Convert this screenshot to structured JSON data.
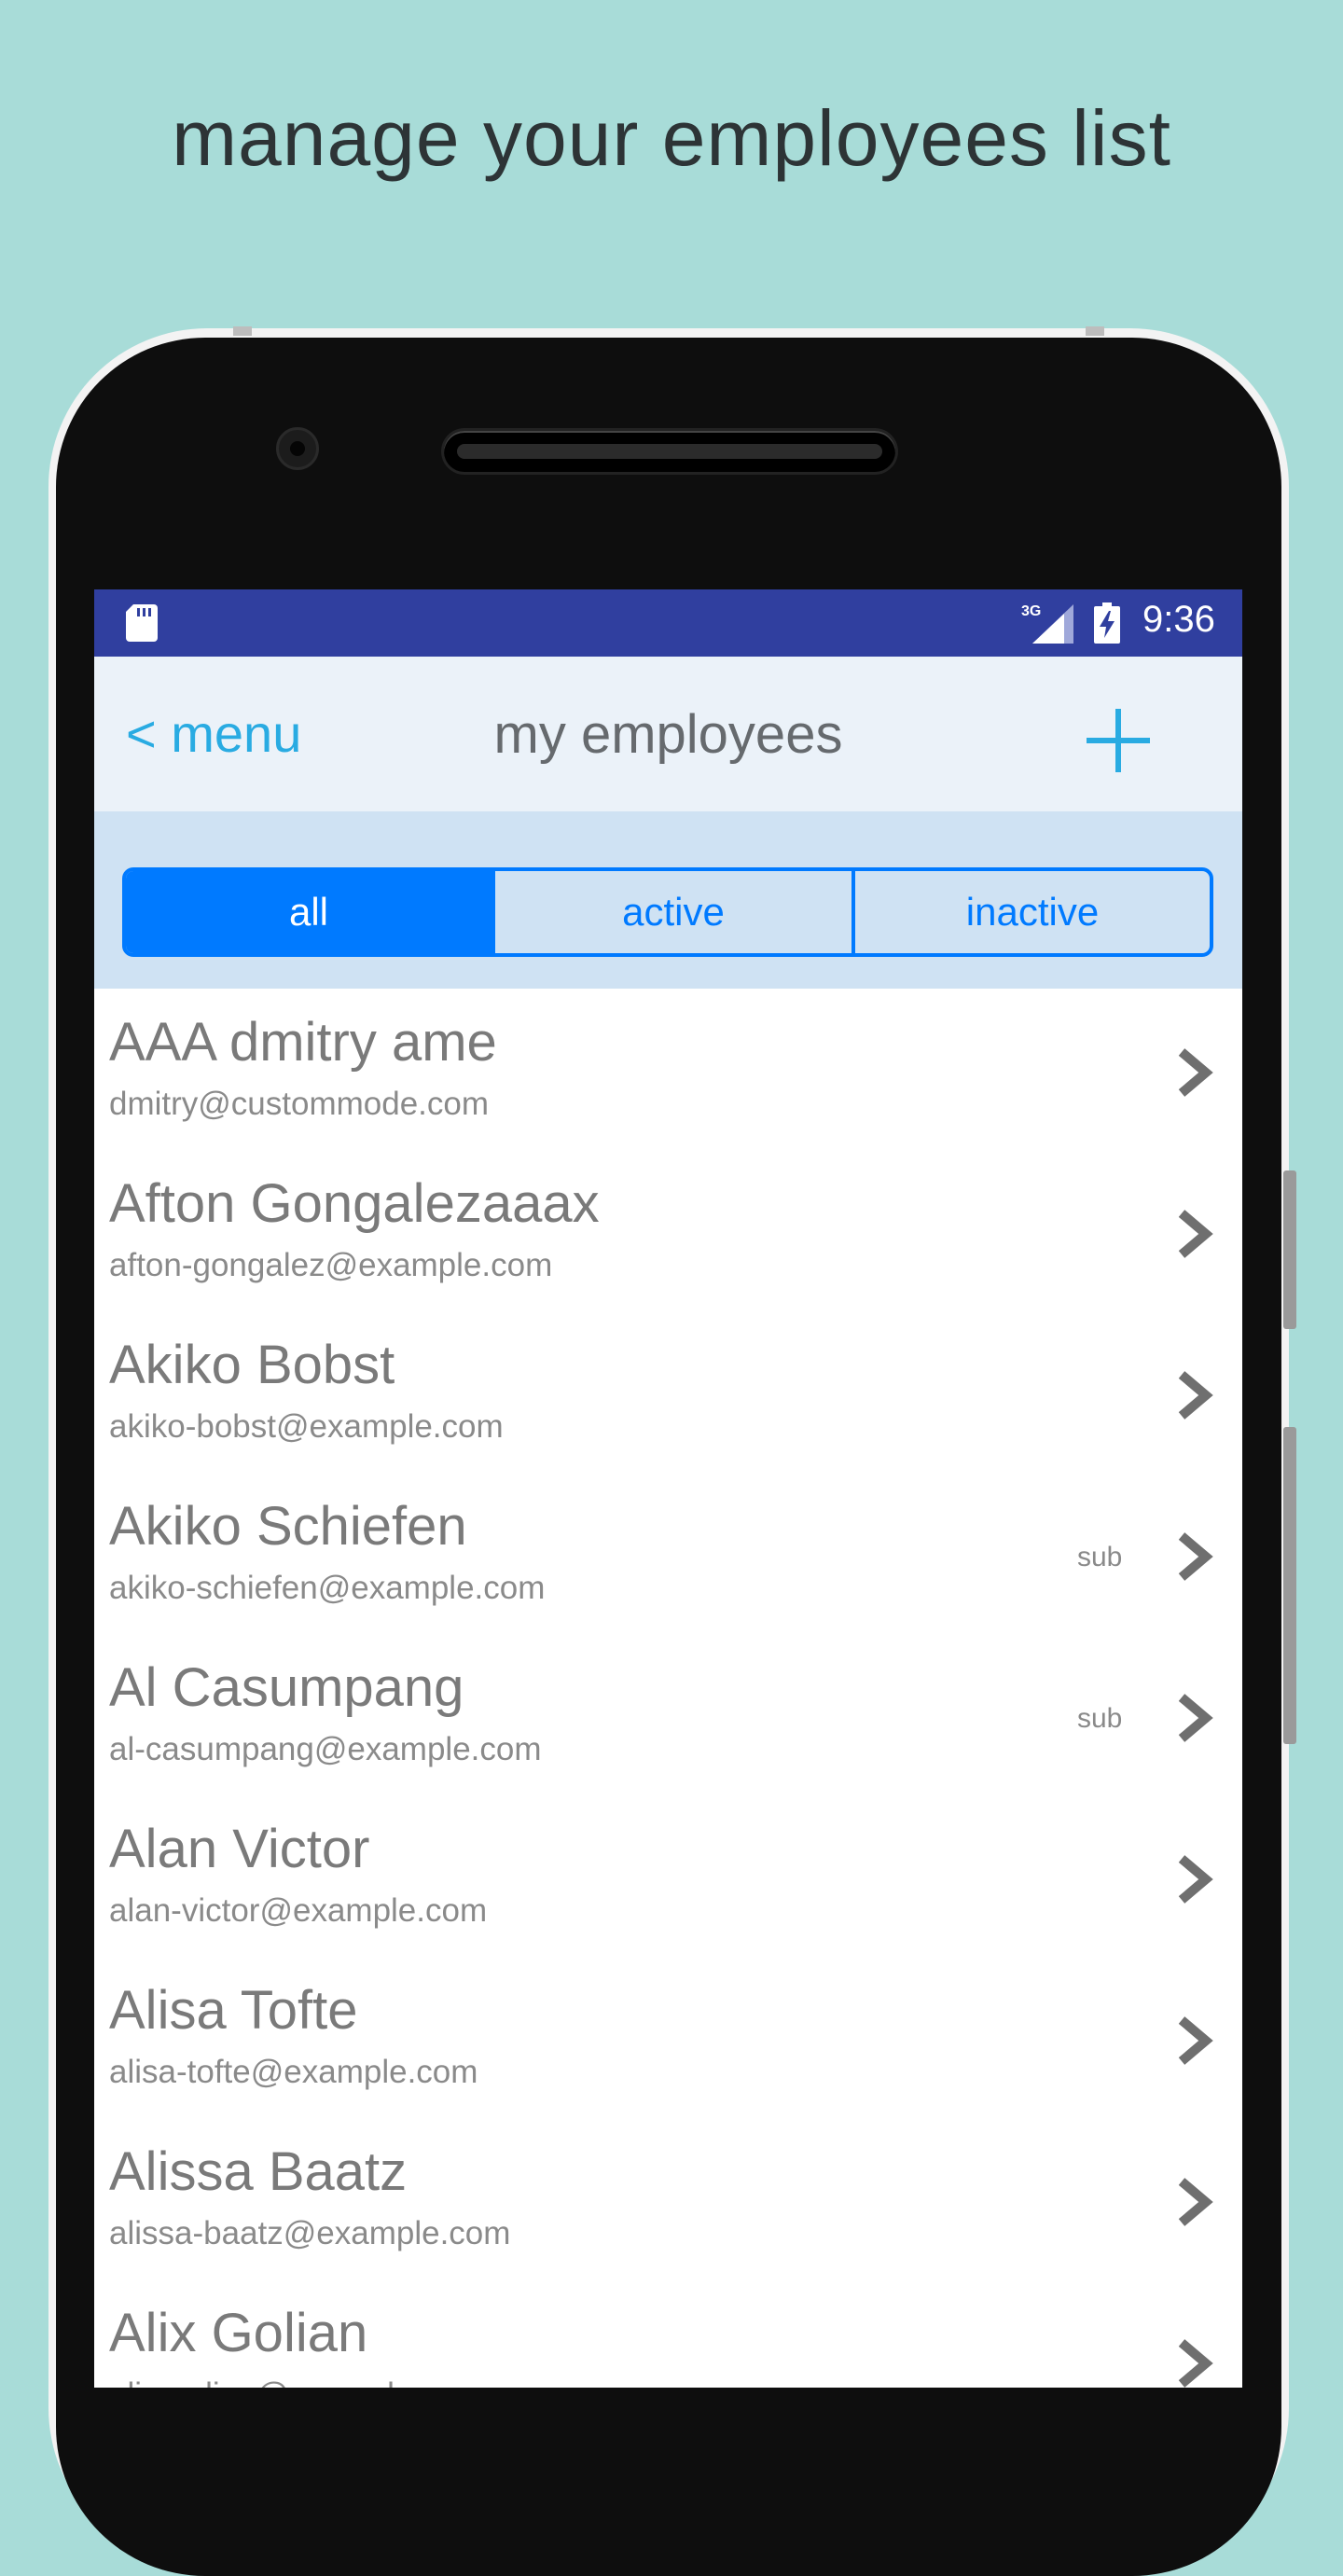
{
  "headline": "manage your employees list",
  "statusbar": {
    "time": "9:36",
    "network": "3G"
  },
  "navbar": {
    "back_label": "< menu",
    "title": "my employees"
  },
  "filter": {
    "tabs": [
      "all",
      "active",
      "inactive"
    ],
    "selected": "all"
  },
  "employees": [
    {
      "name": "AAA dmitry ame",
      "email": "dmitry@custommode.com",
      "badge": ""
    },
    {
      "name": "Afton Gongalezaaax",
      "email": "afton-gongalez@example.com",
      "badge": ""
    },
    {
      "name": "Akiko Bobst",
      "email": "akiko-bobst@example.com",
      "badge": ""
    },
    {
      "name": "Akiko Schiefen",
      "email": "akiko-schiefen@example.com",
      "badge": "sub"
    },
    {
      "name": "Al Casumpang",
      "email": "al-casumpang@example.com",
      "badge": "sub"
    },
    {
      "name": "Alan Victor",
      "email": "alan-victor@example.com",
      "badge": ""
    },
    {
      "name": "Alisa Tofte",
      "email": "alisa-tofte@example.com",
      "badge": ""
    },
    {
      "name": "Alissa Baatz",
      "email": "alissa-baatz@example.com",
      "badge": ""
    },
    {
      "name": "Alix Golian",
      "email": "alix-golian@example.com",
      "badge": ""
    }
  ],
  "colors": {
    "background": "#a8dcd8",
    "statusbar": "#303f9f",
    "accent": "#007aff",
    "link": "#29abe2"
  }
}
